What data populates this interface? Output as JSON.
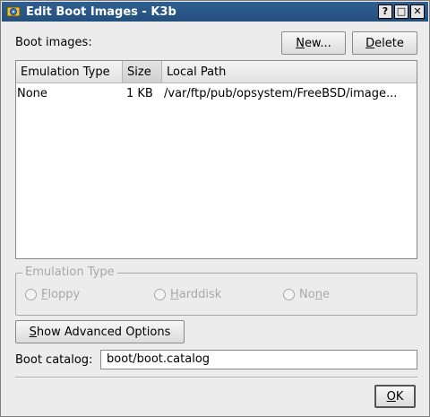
{
  "window": {
    "title": "Edit Boot Images - K3b",
    "titlebar_buttons": [
      "?",
      "□",
      "✕"
    ]
  },
  "boot_images": {
    "label": "Boot images:",
    "new_button": {
      "pre": "",
      "mnemonic": "N",
      "post": "ew..."
    },
    "delete_button": {
      "pre": "",
      "mnemonic": "D",
      "post": "elete"
    }
  },
  "list": {
    "columns": [
      "Emulation Type",
      "Size",
      "Local Path"
    ],
    "rows": [
      {
        "emulation": "None",
        "size": "1 KB",
        "path": "/var/ftp/pub/opsystem/FreeBSD/image..."
      }
    ]
  },
  "emulation_group": {
    "title": "Emulation Type",
    "options": [
      {
        "pre": "",
        "mnemonic": "F",
        "post": "loppy"
      },
      {
        "pre": "",
        "mnemonic": "H",
        "post": "arddisk"
      },
      {
        "pre": "No",
        "mnemonic": "n",
        "post": "e"
      }
    ]
  },
  "advanced_button": {
    "pre": "",
    "mnemonic": "S",
    "post": "how Advanced Options"
  },
  "boot_catalog": {
    "label": "Boot catalog:",
    "value": "boot/boot.catalog"
  },
  "ok_button": {
    "pre": "",
    "mnemonic": "O",
    "post": "K"
  },
  "colors": {
    "titlebar": "#2f5f91",
    "window_bg": "#ececec",
    "disabled_text": "#a8a8a8"
  },
  "icons": {
    "app": "k3b-app-icon"
  }
}
